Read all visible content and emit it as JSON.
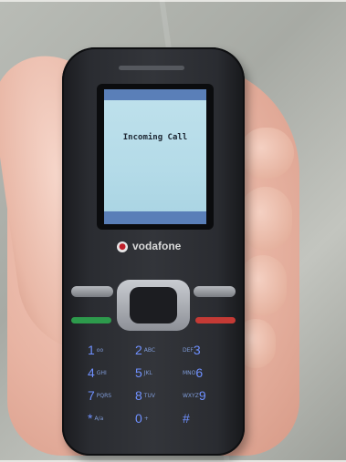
{
  "screen": {
    "message": "Incoming Call"
  },
  "brand": {
    "name": "vodafone"
  },
  "keypad": {
    "rows": [
      [
        {
          "digit": "1",
          "letters": "oo"
        },
        {
          "digit": "2",
          "letters": "ABC"
        },
        {
          "digit": "3",
          "letters": "DEF"
        }
      ],
      [
        {
          "digit": "4",
          "letters": "GHI"
        },
        {
          "digit": "5",
          "letters": "JKL"
        },
        {
          "digit": "6",
          "letters": "MNO"
        }
      ],
      [
        {
          "digit": "7",
          "letters": "PQRS"
        },
        {
          "digit": "8",
          "letters": "TUV"
        },
        {
          "digit": "9",
          "letters": "WXYZ"
        }
      ],
      [
        {
          "digit": "*",
          "letters": "A/a"
        },
        {
          "digit": "0",
          "letters": "+"
        },
        {
          "digit": "#",
          "letters": ""
        }
      ]
    ]
  },
  "colors": {
    "screen": "#b4dbe8",
    "status_bar": "#5a7fb8",
    "keypad_text": "#6f90ff",
    "call_key": "#2d9a4c",
    "end_key": "#c43a35"
  }
}
